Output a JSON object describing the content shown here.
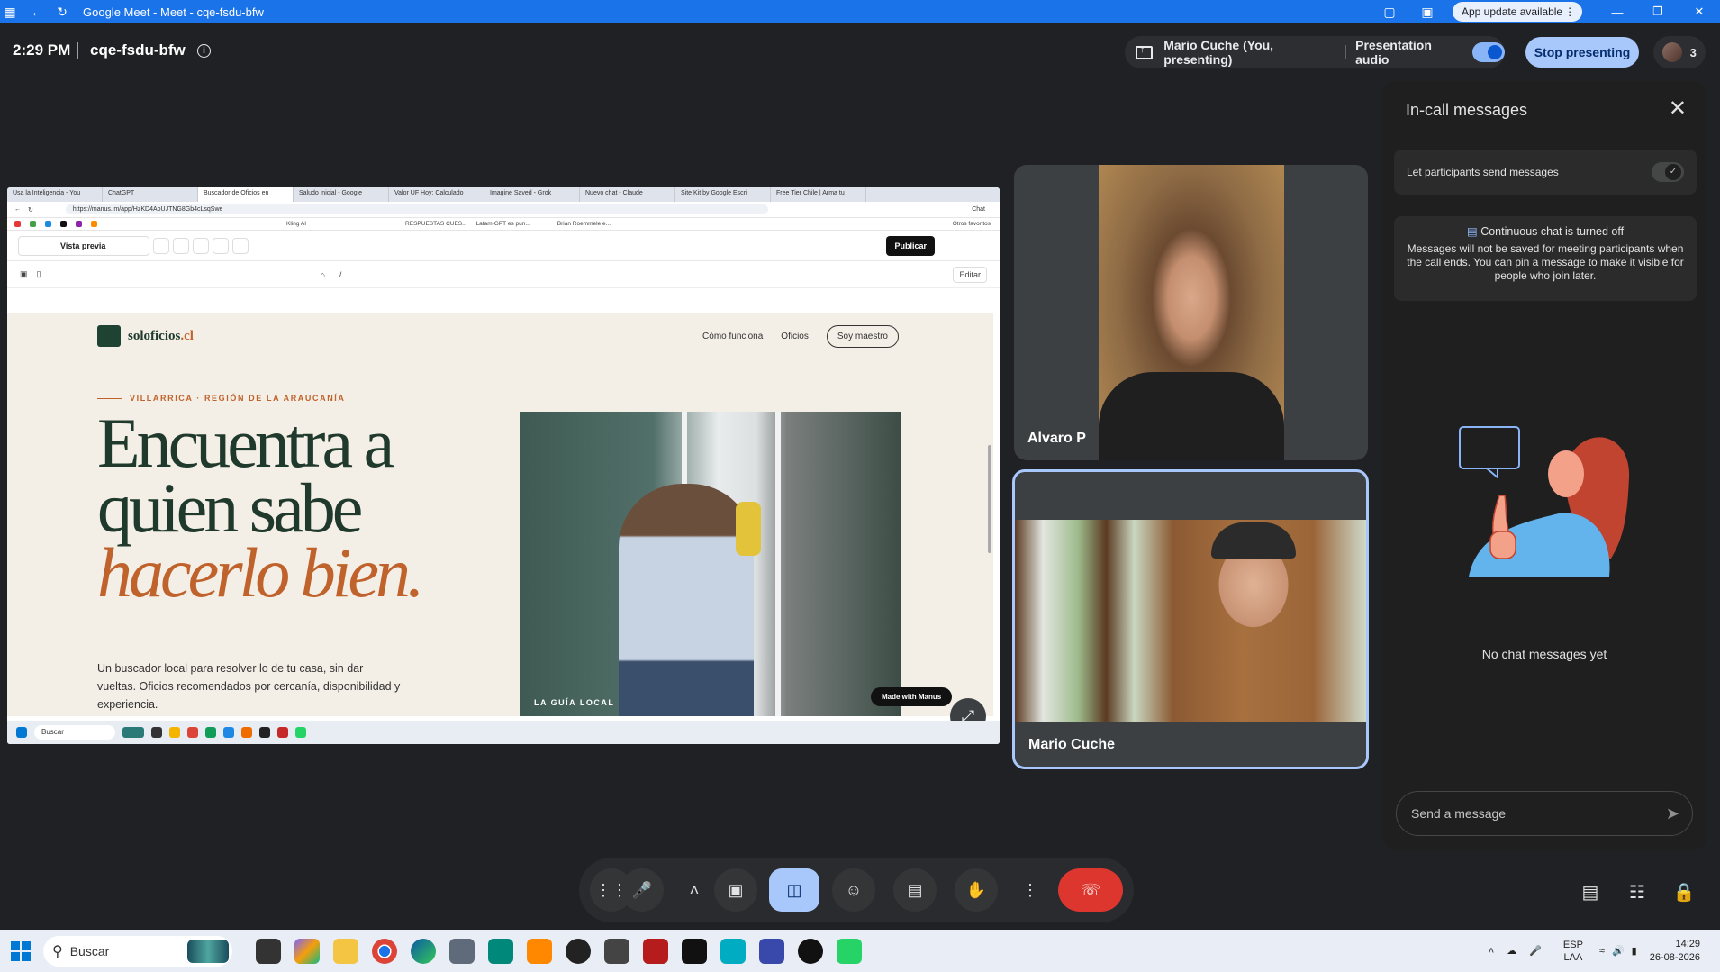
{
  "window": {
    "title": "Google Meet - Meet - cqe-fsdu-bfw",
    "app_update": "App update available"
  },
  "meet": {
    "time": "2:29 PM",
    "code": "cqe-fsdu-bfw",
    "presenter_label": "Mario Cuche (You, presenting)",
    "presentation_audio_label": "Presentation audio",
    "stop_presenting_label": "Stop presenting",
    "participant_count": "3"
  },
  "shared_screen": {
    "tabs": [
      "Usa la Inteligencia - You",
      "ChatGPT",
      "Buscador de Oficios en",
      "Saludo inicial - Google",
      "Valor UF Hoy: Calculado",
      "Imagine Saved - Grok",
      "Nuevo chat - Claude",
      "Site Kit by Google Escri",
      "Free Tier Chile | Arma tu"
    ],
    "url": "https://manus.im/app/HzKD4AoUJTNG8Gb4cLsqSwe",
    "bookmarks": [
      "Kling AI",
      "RESPUESTAS CUES...",
      "Latam-GPT es pun...",
      "Brian Roemmele e...",
      "Otros favoritos"
    ],
    "chat_button": "Chat",
    "vista_previa": "Vista previa",
    "publicar": "Publicar",
    "path": "/",
    "editar": "Editar",
    "site": {
      "logo_name": "soloficios",
      "logo_tld": ".cl",
      "nav_links": [
        "Cómo funciona",
        "Oficios"
      ],
      "nav_cta": "Soy maestro",
      "kicker": "VILLARRICA · REGIÓN DE LA ARAUCANÍA",
      "headline_1": "Encuentra a",
      "headline_2": "quien sabe",
      "headline_3": "hacerlo bien.",
      "subtitle": "Un buscador local para resolver lo de tu casa, sin dar vueltas. Oficios recomendados por cercanía, disponibilidad y experiencia.",
      "image_caption": "LA GUÍA LOCAL",
      "made_with": "Made with Manus"
    },
    "inner_search": "Buscar"
  },
  "participants": [
    {
      "name": "Alvaro P"
    },
    {
      "name": "Mario Cuche"
    }
  ],
  "chat": {
    "title": "In-call messages",
    "let_send_label": "Let participants send messages",
    "continuous_title": "Continuous chat is turned off",
    "continuous_body": "Messages will not be saved for meeting participants when the call ends. You can pin a message to make it visible for people who join later.",
    "empty_label": "No chat messages yet",
    "input_placeholder": "Send a message"
  },
  "taskbar": {
    "search_placeholder": "Buscar",
    "lang": "ESP",
    "lang_sub": "LAA",
    "time": "14:29",
    "date": "26-08-2026"
  },
  "colors": {
    "meet_bg": "#202124",
    "accent": "#a8c7fa",
    "end_call": "#dc362e",
    "brand_green": "#1f3a2c",
    "brand_terracotta": "#c0622c"
  }
}
